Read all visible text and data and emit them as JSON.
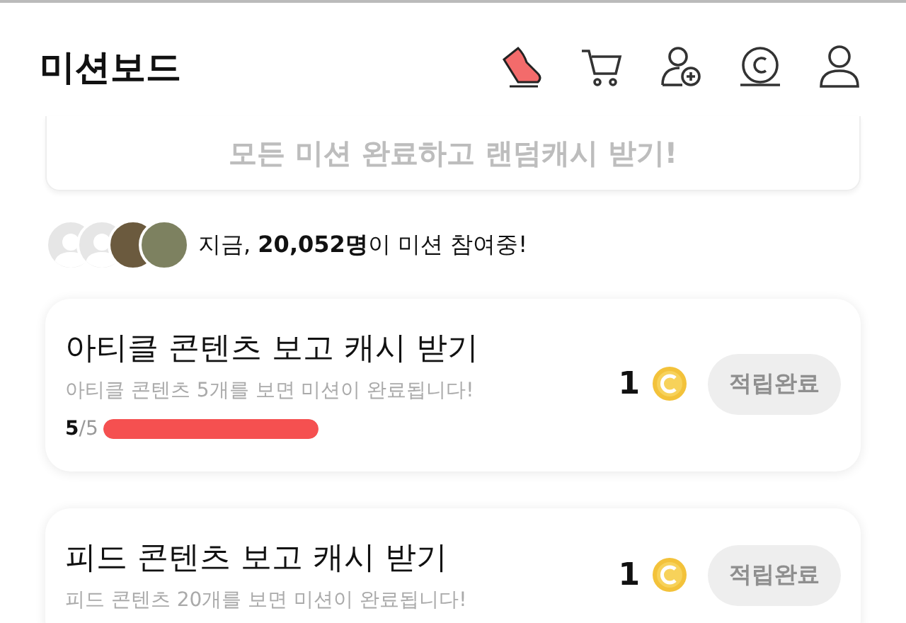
{
  "header": {
    "title": "미션보드"
  },
  "banner": {
    "text": "모든 미션 완료하고 랜덤캐시 받기!"
  },
  "participants": {
    "avatars": [
      {
        "kind": "default"
      },
      {
        "kind": "default"
      },
      {
        "kind": "photo"
      },
      {
        "kind": "photo"
      }
    ],
    "text": "지금, **20,052명**이 미션 참여중!"
  },
  "missions": [
    {
      "title": "아티클 콘텐츠 보고 캐시 받기",
      "description": "아티클 콘텐츠 5개를 보면 미션이 완료됩니다!",
      "progress": "**5**/5",
      "level": 1,
      "reward": "1",
      "button": "적립완료",
      "disabled": true
    },
    {
      "title": "피드 콘텐츠 보고 캐시 받기",
      "description": "피드 콘텐츠 20개를 보면 미션이 완료됩니다!",
      "reward": "1",
      "button": "적립완료",
      "disabled": true
    }
  ]
}
